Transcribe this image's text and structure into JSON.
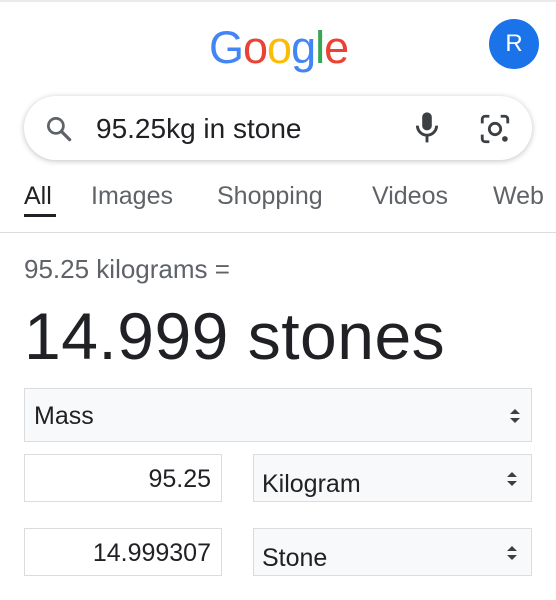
{
  "header": {
    "logo_text": "Google",
    "logo_colors": [
      "#4285F4",
      "#EA4335",
      "#FBBC05",
      "#4285F4",
      "#34A853",
      "#EA4335"
    ],
    "avatar_initial": "R",
    "avatar_color": "#1a73e8"
  },
  "search": {
    "query": "95.25kg in stone",
    "icons": [
      "search-icon",
      "mic-icon",
      "lens-icon"
    ]
  },
  "tabs": [
    {
      "label": "All",
      "active": true
    },
    {
      "label": "Images",
      "active": false
    },
    {
      "label": "Shopping",
      "active": false
    },
    {
      "label": "Videos",
      "active": false
    },
    {
      "label": "Web",
      "active": false
    }
  ],
  "converter": {
    "from_text": "95.25 kilograms =",
    "result_text": "14.999 stones",
    "category": "Mass",
    "from_value": "95.25",
    "from_unit": "Kilogram",
    "to_value": "14.999307",
    "to_unit": "Stone"
  }
}
